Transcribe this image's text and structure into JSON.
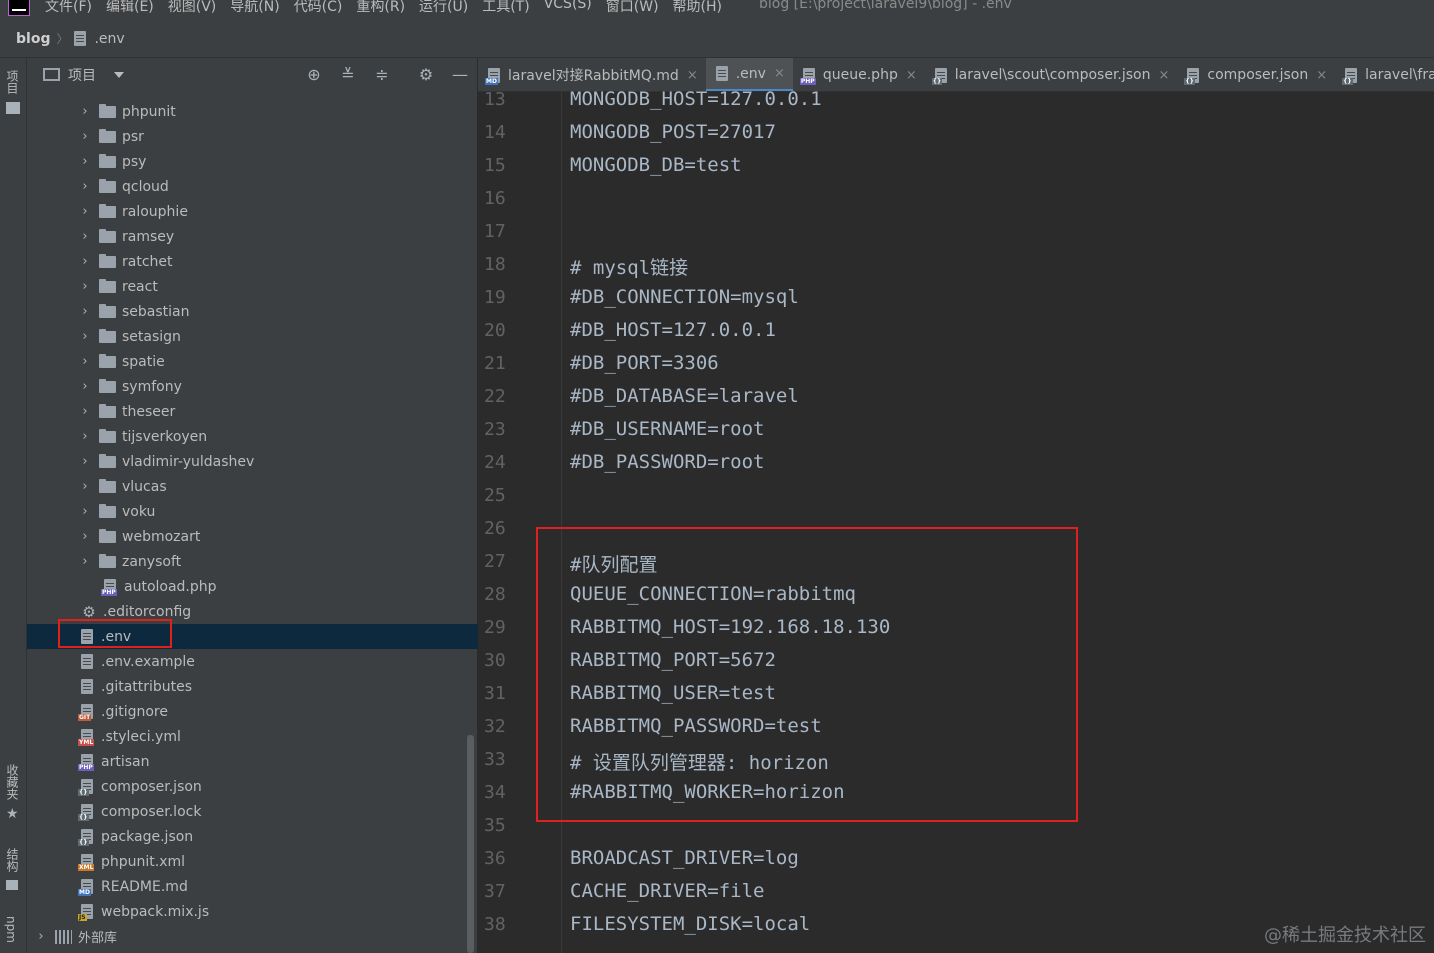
{
  "menubar": {
    "items": [
      "文件(F)",
      "编辑(E)",
      "视图(V)",
      "导航(N)",
      "代码(C)",
      "重构(R)",
      "运行(U)",
      "工具(T)",
      "VCS(S)",
      "窗口(W)",
      "帮助(H)"
    ],
    "window_title": "blog [E:\\project\\laravel9\\blog] - .env"
  },
  "breadcrumb": {
    "project": "blog",
    "file": ".env"
  },
  "toolstrip": {
    "project": "项目",
    "favorites": "收藏夹",
    "structure": "结构",
    "npm": "npm"
  },
  "project_panel": {
    "title": "项目",
    "tree": [
      {
        "label": "phpunit",
        "kind": "folder",
        "indent": 1
      },
      {
        "label": "psr",
        "kind": "folder",
        "indent": 1
      },
      {
        "label": "psy",
        "kind": "folder",
        "indent": 1
      },
      {
        "label": "qcloud",
        "kind": "folder",
        "indent": 1
      },
      {
        "label": "ralouphie",
        "kind": "folder",
        "indent": 1
      },
      {
        "label": "ramsey",
        "kind": "folder",
        "indent": 1
      },
      {
        "label": "ratchet",
        "kind": "folder",
        "indent": 1
      },
      {
        "label": "react",
        "kind": "folder",
        "indent": 1
      },
      {
        "label": "sebastian",
        "kind": "folder",
        "indent": 1
      },
      {
        "label": "setasign",
        "kind": "folder",
        "indent": 1
      },
      {
        "label": "spatie",
        "kind": "folder",
        "indent": 1
      },
      {
        "label": "symfony",
        "kind": "folder",
        "indent": 1
      },
      {
        "label": "theseer",
        "kind": "folder",
        "indent": 1
      },
      {
        "label": "tijsverkoyen",
        "kind": "folder",
        "indent": 1
      },
      {
        "label": "vladimir-yuldashev",
        "kind": "folder",
        "indent": 1
      },
      {
        "label": "vlucas",
        "kind": "folder",
        "indent": 1
      },
      {
        "label": "voku",
        "kind": "folder",
        "indent": 1
      },
      {
        "label": "webmozart",
        "kind": "folder",
        "indent": 1
      },
      {
        "label": "zanysoft",
        "kind": "folder",
        "indent": 1
      },
      {
        "label": "autoload.php",
        "kind": "file",
        "badge": "PHP",
        "indent": 2
      },
      {
        "label": ".editorconfig",
        "kind": "gear",
        "indent": 0
      },
      {
        "label": ".env",
        "kind": "file",
        "badge": "",
        "indent": 0,
        "selected": true
      },
      {
        "label": ".env.example",
        "kind": "file",
        "badge": "",
        "indent": 0
      },
      {
        "label": ".gitattributes",
        "kind": "file",
        "badge": "",
        "indent": 0
      },
      {
        "label": ".gitignore",
        "kind": "file",
        "badge": "GIT",
        "indent": 0
      },
      {
        "label": ".styleci.yml",
        "kind": "file",
        "badge": "YML",
        "indent": 0
      },
      {
        "label": "artisan",
        "kind": "file",
        "badge": "PHP",
        "indent": 0
      },
      {
        "label": "composer.json",
        "kind": "file",
        "badge": "{}",
        "indent": 0
      },
      {
        "label": "composer.lock",
        "kind": "file",
        "badge": "{}",
        "indent": 0
      },
      {
        "label": "package.json",
        "kind": "file",
        "badge": "{}",
        "indent": 0
      },
      {
        "label": "phpunit.xml",
        "kind": "file",
        "badge": "XML",
        "indent": 0
      },
      {
        "label": "README.md",
        "kind": "file",
        "badge": "MD",
        "indent": 0
      },
      {
        "label": "webpack.mix.js",
        "kind": "file",
        "badge": "JS",
        "indent": 0
      },
      {
        "label": "外部库",
        "kind": "libs",
        "indent": -1
      }
    ]
  },
  "editor": {
    "tabs": [
      {
        "label": "laravel对接RabbitMQ.md",
        "badge": "MD",
        "active": false
      },
      {
        "label": ".env",
        "badge": "",
        "active": true
      },
      {
        "label": "queue.php",
        "badge": "PHP",
        "active": false
      },
      {
        "label": "laravel\\scout\\composer.json",
        "badge": "{}",
        "active": false
      },
      {
        "label": "composer.json",
        "badge": "{}",
        "active": false
      },
      {
        "label": "laravel\\frame",
        "badge": "{}",
        "active": false
      }
    ],
    "lines": [
      {
        "n": "13",
        "text": "MONGODB_HOST=127.0.0.1"
      },
      {
        "n": "14",
        "text": "MONGODB_POST=27017"
      },
      {
        "n": "15",
        "text": "MONGODB_DB=test"
      },
      {
        "n": "16",
        "text": ""
      },
      {
        "n": "17",
        "text": ""
      },
      {
        "n": "18",
        "text": "# mysql链接"
      },
      {
        "n": "19",
        "text": "#DB_CONNECTION=mysql"
      },
      {
        "n": "20",
        "text": "#DB_HOST=127.0.0.1"
      },
      {
        "n": "21",
        "text": "#DB_PORT=3306"
      },
      {
        "n": "22",
        "text": "#DB_DATABASE=laravel"
      },
      {
        "n": "23",
        "text": "#DB_USERNAME=root"
      },
      {
        "n": "24",
        "text": "#DB_PASSWORD=root"
      },
      {
        "n": "25",
        "text": ""
      },
      {
        "n": "26",
        "text": ""
      },
      {
        "n": "27",
        "text": "#队列配置"
      },
      {
        "n": "28",
        "text": "QUEUE_CONNECTION=rabbitmq"
      },
      {
        "n": "29",
        "text": "RABBITMQ_HOST=192.168.18.130"
      },
      {
        "n": "30",
        "text": "RABBITMQ_PORT=5672"
      },
      {
        "n": "31",
        "text": "RABBITMQ_USER=test"
      },
      {
        "n": "32",
        "text": "RABBITMQ_PASSWORD=test"
      },
      {
        "n": "33",
        "text": "# 设置队列管理器: horizon"
      },
      {
        "n": "34",
        "text": "#RABBITMQ_WORKER=horizon"
      },
      {
        "n": "35",
        "text": ""
      },
      {
        "n": "36",
        "text": "BROADCAST_DRIVER=log"
      },
      {
        "n": "37",
        "text": "CACHE_DRIVER=file"
      },
      {
        "n": "38",
        "text": "FILESYSTEM_DISK=local"
      }
    ]
  },
  "watermark": "@稀土掘金技术社区"
}
